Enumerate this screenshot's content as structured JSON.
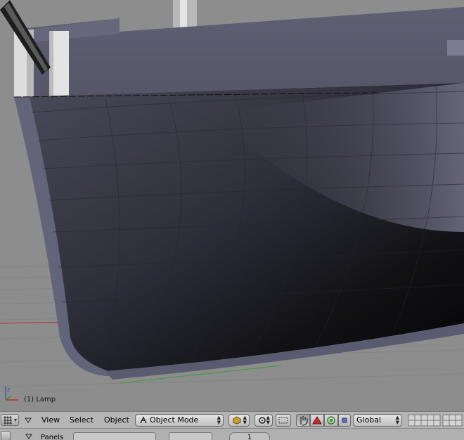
{
  "viewport": {
    "object_info": "(1) Lamp"
  },
  "header": {
    "menus": [
      "View",
      "Select",
      "Object"
    ],
    "mode_select": "Object Mode",
    "orientation_select": "Global",
    "icons": [
      "view-type-grid-icon",
      "collapse-triangle-icon",
      "object-mode-icon",
      "shading-cube-icon",
      "pivot-icon",
      "manipulator-toggle-icon",
      "translate-hand-icon",
      "rotate-icon",
      "scale-icon",
      "layers-icon"
    ]
  },
  "header2": {
    "panels_label": "Panels",
    "frame_value": "1"
  },
  "colors": {
    "hull_dark": "#101010",
    "hull_light": "#5b5c70",
    "background": "#8d8d8d",
    "header": "#b5b5b5"
  }
}
